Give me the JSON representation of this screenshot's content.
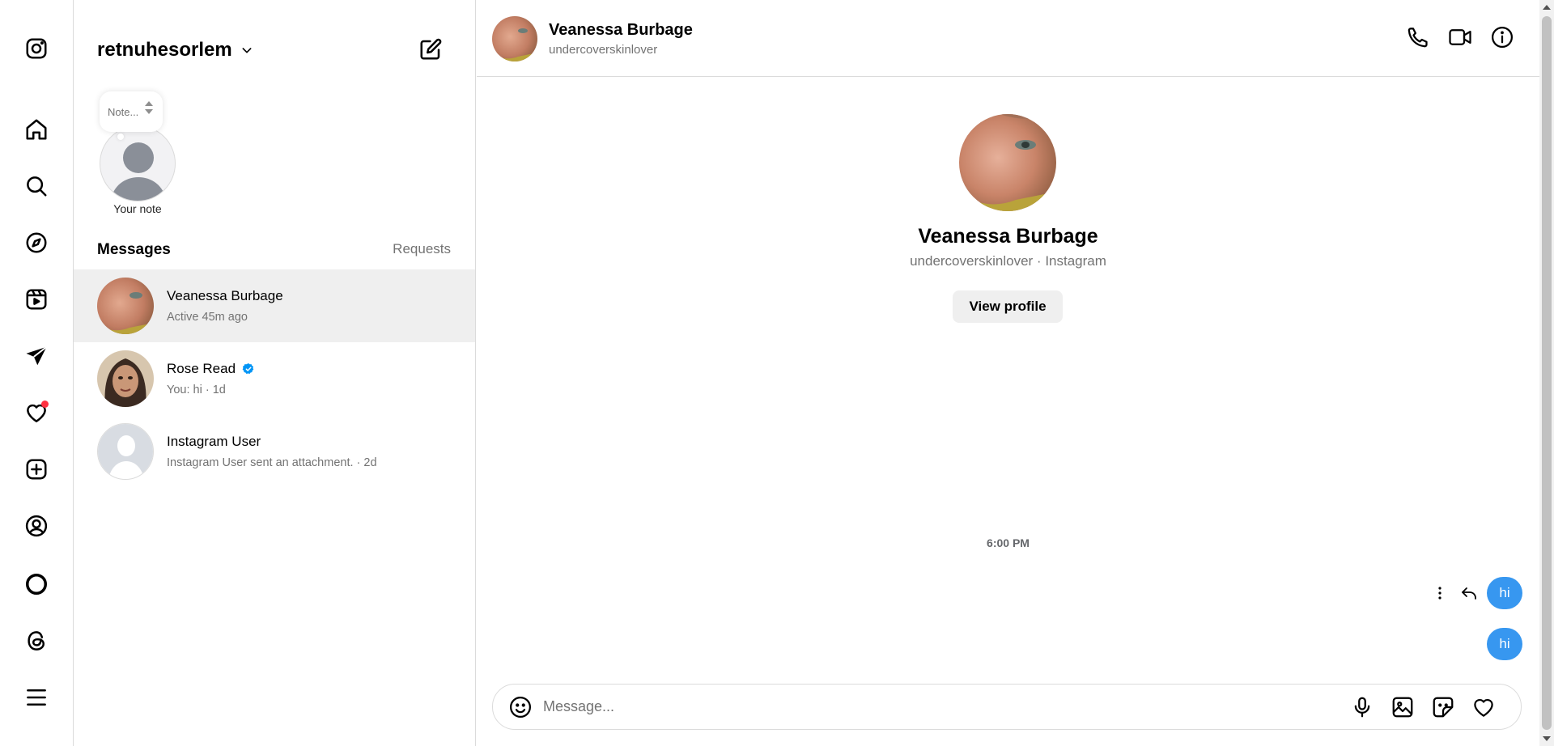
{
  "nav": {
    "items": [
      {
        "name": "instagram-logo-icon"
      },
      {
        "name": "home-icon"
      },
      {
        "name": "search-icon"
      },
      {
        "name": "explore-icon"
      },
      {
        "name": "reels-icon"
      },
      {
        "name": "messages-icon"
      },
      {
        "name": "notifications-icon"
      },
      {
        "name": "create-icon"
      },
      {
        "name": "profile-icon"
      },
      {
        "name": "meta-ai-icon"
      },
      {
        "name": "threads-icon"
      },
      {
        "name": "more-menu-icon"
      }
    ],
    "notification_dot_color": "#ff3040"
  },
  "inbox": {
    "account_name": "retnuhesorlem",
    "note_placeholder": "Note...",
    "note_label": "Your note",
    "messages_heading": "Messages",
    "requests_link": "Requests",
    "threads": [
      {
        "name": "Veanessa Burbage",
        "subtitle": "Active 45m ago",
        "active": true,
        "verified": false
      },
      {
        "name": "Rose Read",
        "subtitle": "You: hi · 1d",
        "active": false,
        "verified": true
      },
      {
        "name": "Instagram User",
        "subtitle": "Instagram User sent an attachment. · 2d",
        "active": false,
        "verified": false
      }
    ]
  },
  "chat": {
    "header": {
      "name": "Veanessa Burbage",
      "username": "undercoverskinlover"
    },
    "profile": {
      "name": "Veanessa Burbage",
      "subtitle": "undercoverskinlover · Instagram",
      "view_profile_label": "View profile"
    },
    "timestamp": "6:00 PM",
    "messages": [
      {
        "text": "hi",
        "from_me": true
      },
      {
        "text": "hi",
        "from_me": true
      }
    ],
    "composer": {
      "placeholder": "Message..."
    },
    "accent_color": "#3797f0"
  }
}
